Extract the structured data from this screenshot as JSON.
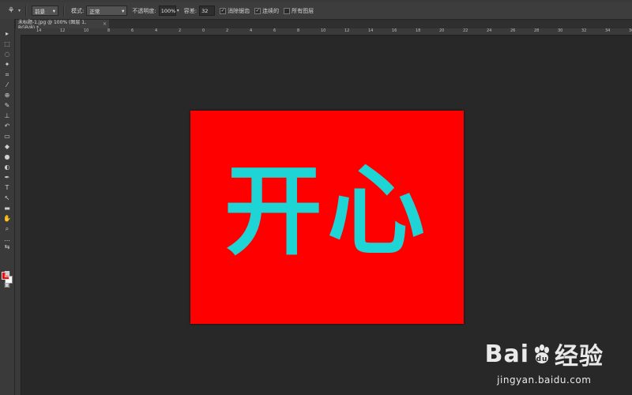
{
  "options_bar": {
    "preset_value": "前景",
    "mode_label": "模式:",
    "mode_value": "正常",
    "opacity_label": "不透明度:",
    "opacity_value": "100%",
    "tolerance_label": "容差:",
    "tolerance_value": "32",
    "anti_alias_label": "消除锯齿",
    "contiguous_label": "连续的",
    "all_layers_label": "所有图层"
  },
  "document_tab": {
    "title": "未标题-1.jpg @ 100% (图层 1, RGB/8) *",
    "close": "×"
  },
  "rulers": {
    "top_ticks": [
      "14",
      "12",
      "10",
      "8",
      "6",
      "4",
      "2",
      "0",
      "2",
      "4",
      "6",
      "8",
      "10",
      "12",
      "14",
      "16",
      "18",
      "20",
      "22",
      "24",
      "26",
      "28",
      "30",
      "32",
      "34",
      "36"
    ]
  },
  "canvas": {
    "text": "开心",
    "background_color": "#ff0000",
    "text_color": "#1ed4d4"
  },
  "colors": {
    "foreground": "#ff0000",
    "background": "#ffffff"
  },
  "watermark": {
    "logo_left": "Bai",
    "logo_right": "经验",
    "url": "jingyan.baidu.com"
  }
}
